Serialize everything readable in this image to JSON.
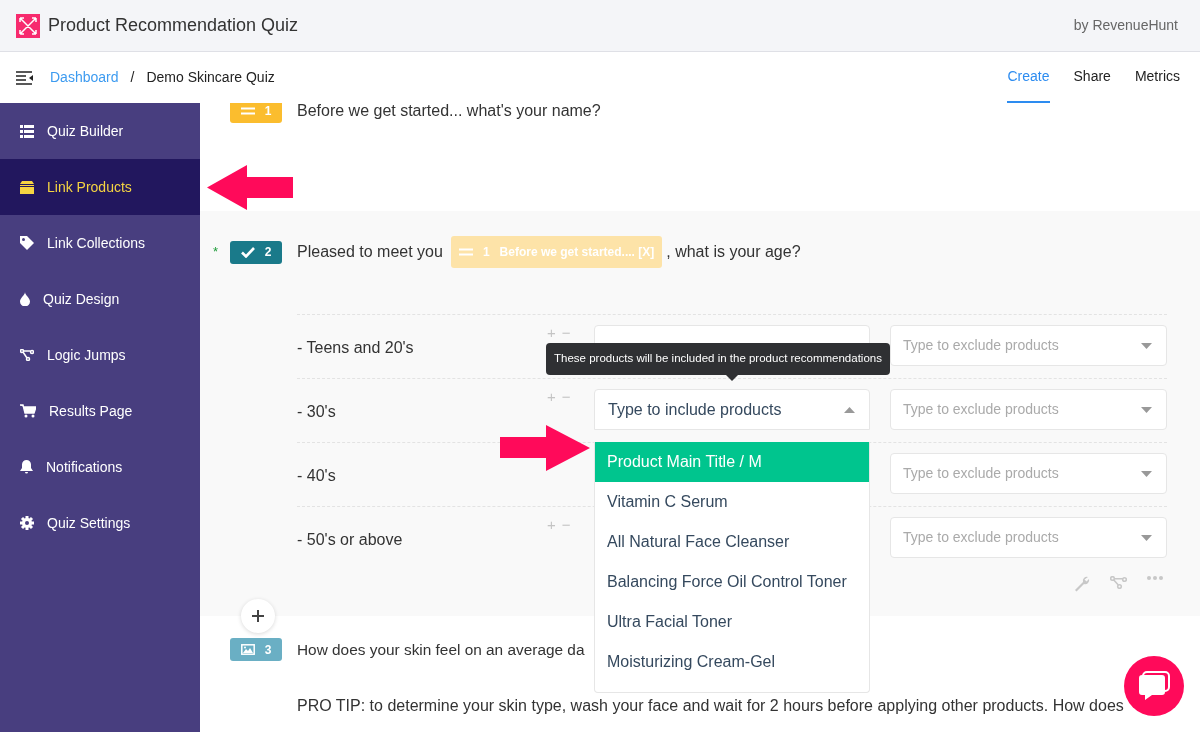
{
  "app": {
    "title": "Product Recommendation Quiz",
    "byline": "by RevenueHunt"
  },
  "breadcrumb": [
    {
      "label": "Dashboard",
      "link": true
    },
    {
      "label": "Demo Skincare Quiz",
      "link": false
    }
  ],
  "breadcrumb_separator": "/",
  "tabs": [
    {
      "label": "Create",
      "selected": true
    },
    {
      "label": "Share",
      "selected": false
    },
    {
      "label": "Metrics",
      "selected": false
    }
  ],
  "sidebar": {
    "items": [
      {
        "label": "Quiz Builder",
        "selected": false
      },
      {
        "label": "Link Products",
        "selected": true
      },
      {
        "label": "Link Collections",
        "selected": false
      },
      {
        "label": "Quiz Design",
        "selected": false
      },
      {
        "label": "Logic Jumps",
        "selected": false
      },
      {
        "label": "Results Page",
        "selected": false
      },
      {
        "label": "Notifications",
        "selected": false
      },
      {
        "label": "Quiz Settings",
        "selected": false
      }
    ]
  },
  "questions": [
    {
      "number": "1",
      "kind": "text",
      "color": "#fbbd2e",
      "title_parts": [
        {
          "kind": "text",
          "text": "Before we get started... what's your name?"
        }
      ]
    },
    {
      "number": "2",
      "kind": "choice",
      "color": "#1a7a8a",
      "required_mark": "*",
      "title_parts": [
        {
          "kind": "text",
          "text": "Pleased to meet you"
        },
        {
          "kind": "tag",
          "number": "1",
          "text": "Before we get started.... [X]"
        },
        {
          "kind": "text",
          "text": ", what is your age?"
        }
      ],
      "answers": [
        {
          "label": "- Teens and 20's",
          "step_buttons": [
            "+",
            "−"
          ],
          "include_field": true,
          "exclude": {
            "placeholder": "Type to exclude products"
          }
        },
        {
          "label": "- 30's",
          "step_buttons": [
            "+",
            "−"
          ],
          "include": {
            "open": true,
            "placeholder": "Type to include products",
            "options": [
              {
                "label": "Product Main Title / M",
                "selected": true
              },
              {
                "label": "Vitamin C Serum",
                "selected": false
              },
              {
                "label": "All Natural Face Cleanser",
                "selected": false
              },
              {
                "label": "Balancing Force Oil Control Toner",
                "selected": false
              },
              {
                "label": "Ultra Facial Toner",
                "selected": false
              },
              {
                "label": "Moisturizing Cream-Gel",
                "selected": false
              }
            ]
          },
          "exclude": {
            "placeholder": "Type to exclude products"
          }
        },
        {
          "label": "- 40's",
          "exclude": {
            "placeholder": "Type to exclude products"
          }
        },
        {
          "label": "- 50's or above",
          "step_buttons": [
            "+",
            "−"
          ],
          "exclude": {
            "placeholder": "Type to exclude products"
          }
        }
      ]
    },
    {
      "number": "3",
      "kind": "image",
      "color": "#6aafc4",
      "title_parts": [
        {
          "kind": "text",
          "text": "How does your skin feel on an average da"
        }
      ],
      "tip": "PRO TIP: to determine your skin type, wash your face and wait for 2 hours before applying other products. How does"
    }
  ],
  "tooltip": "These products will be included in the product recommendations"
}
